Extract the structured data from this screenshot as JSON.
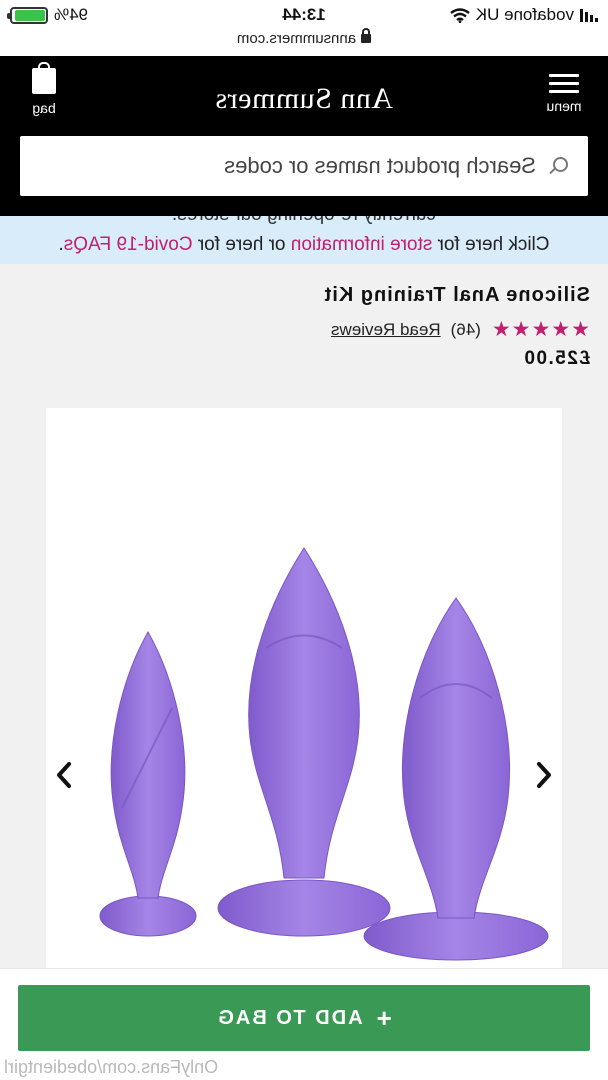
{
  "status_bar": {
    "carrier": "vodafone UK",
    "time": "13:44",
    "battery": "94%",
    "battery_level": 0.94
  },
  "browser": {
    "url": "annsummers.com"
  },
  "header": {
    "menu_label": "menu",
    "brand": "Ann Summers",
    "bag_label": "bag",
    "search_placeholder": "Search product names or codes"
  },
  "banner": {
    "cut_text": "currently re-opening our stores.",
    "lead": "Click here for ",
    "link1": "store information",
    "middle": " or here for ",
    "link2": "Covid-19 FAQs",
    "tail": "."
  },
  "product": {
    "title": "Silicone Anal Training Kit",
    "stars": "★★★★★",
    "rating_fraction": 1.0,
    "review_count": "(46)",
    "reviews_link": "Read Reviews",
    "price": "£25.00"
  },
  "gallery": {
    "prev_icon": "chevron-left-icon",
    "next_icon": "chevron-right-icon"
  },
  "cta": {
    "add_to_bag": "ADD TO BAG",
    "icon": "plus-icon"
  },
  "watermark": "OnlyFans.com/obedientgirl",
  "colors": {
    "accent": "#c2206f",
    "cta": "#3a9a55",
    "banner": "#d8ecfa",
    "product": "#9a76dc"
  }
}
